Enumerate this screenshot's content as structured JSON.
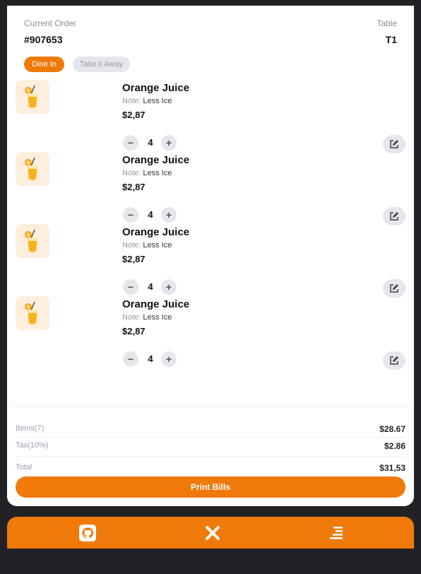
{
  "order": {
    "current_label": "Current Order",
    "number": "#907653",
    "table_label": "Table",
    "table_value": "T1"
  },
  "order_type": {
    "options": [
      "Dine In",
      "Take it Away"
    ],
    "selected": "Dine In"
  },
  "items": [
    {
      "name": "Orange Juice",
      "note_label": "Note:",
      "note": "Less Ice",
      "price": "$2,87",
      "qty": "4",
      "icon": "orange-juice-icon"
    },
    {
      "name": "Orange Juice",
      "note_label": "Note:",
      "note": "Less Ice",
      "price": "$2,87",
      "qty": "4",
      "icon": "orange-juice-icon"
    },
    {
      "name": "Orange Juice",
      "note_label": "Note:",
      "note": "Less Ice",
      "price": "$2,87",
      "qty": "4",
      "icon": "orange-juice-icon"
    },
    {
      "name": "Orange Juice",
      "note_label": "Note:",
      "note": "Less Ice",
      "price": "$2,87",
      "qty": "4",
      "icon": "orange-juice-icon"
    }
  ],
  "summary": {
    "items_label": "Items(7)",
    "items_value": "$28.67",
    "tax_label": "Tax(10%)",
    "tax_value": "$2.86",
    "total_label": "Total",
    "total_value": "$31,53"
  },
  "actions": {
    "print_label": "Print Bills"
  },
  "navbar": {
    "icons": [
      "github-icon",
      "close-icon",
      "menu-icon"
    ]
  },
  "colors": {
    "accent": "#ef7a0a",
    "background": "#222226",
    "card": "#ffffff",
    "muted_button": "#e5e7ec"
  }
}
